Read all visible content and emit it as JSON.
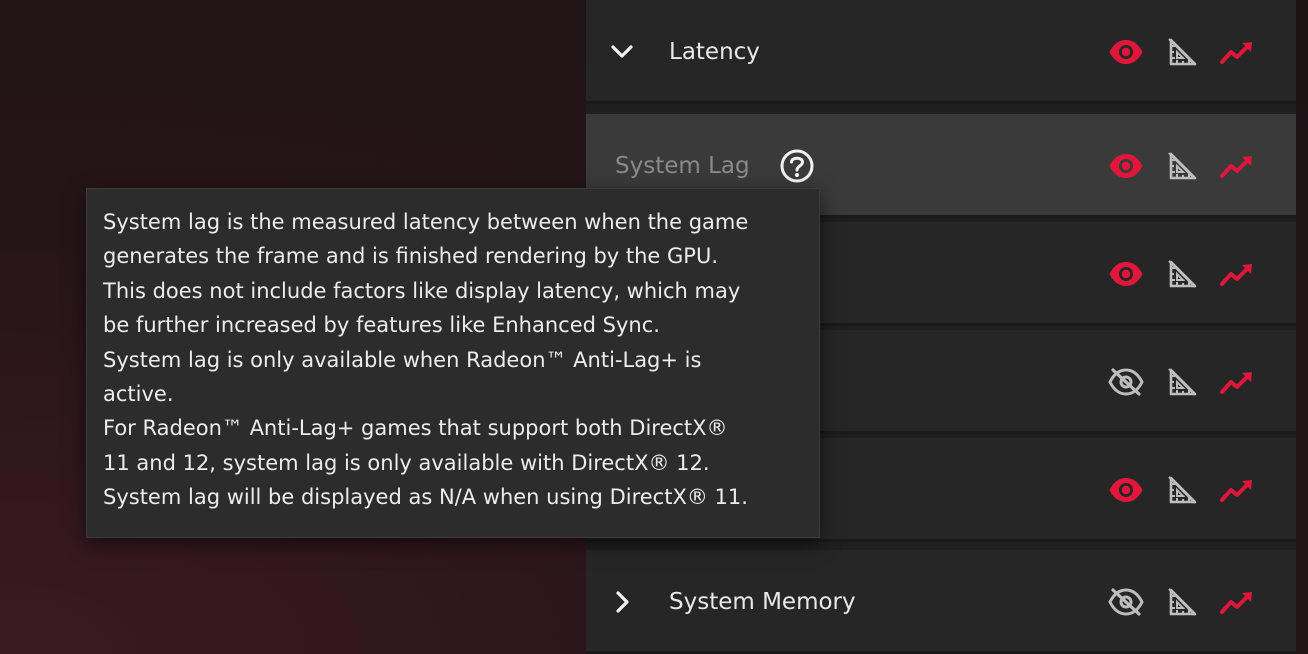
{
  "rows": [
    {
      "label": "Latency",
      "expanded": true
    },
    {
      "label": "System Lag",
      "has_help": true
    },
    {
      "label": ""
    },
    {
      "label": ""
    },
    {
      "label": ""
    },
    {
      "label": "System Memory",
      "expanded": false
    }
  ],
  "tooltip": {
    "lines": [
      "System lag is the measured latency between when the game",
      "generates the frame and is finished rendering by the GPU.",
      "This does not include factors like display latency, which may",
      "be further increased by features like Enhanced Sync.",
      "System lag is only available when Radeon™ Anti-Lag+ is",
      "active.",
      "For Radeon™ Anti-Lag+ games that support both DirectX®",
      "11 and 12, system lag is only available with DirectX® 12.",
      "System lag will be displayed as N/A when using DirectX® 11."
    ]
  },
  "icons": [
    "eye-icon",
    "eye-off-icon",
    "ruler-triangle-icon",
    "trend-chart-icon"
  ],
  "colors": {
    "accent": "#e0173a",
    "icon_gray": "#bdbdbd",
    "panel": "#262626",
    "panel_hover": "#3a3a3a"
  }
}
